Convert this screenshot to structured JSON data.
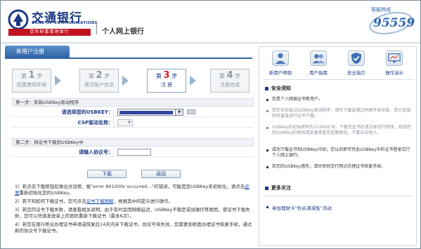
{
  "header": {
    "bank_name_cn": "交通银行",
    "bank_name_en": "BANK OF COMMUNICATIONS",
    "slogan": "您的财富管理银行",
    "system_title": "个人网上银行",
    "hotline_label": "客服热线",
    "hotline_number": "95559"
  },
  "tab": {
    "label": "新用户注册"
  },
  "steps": [
    {
      "prefix": "第",
      "num": "1",
      "suffix": "步",
      "label": "配置使用环境"
    },
    {
      "prefix": "第",
      "num": "2",
      "suffix": "步",
      "label": "填写账户信息"
    },
    {
      "prefix": "第",
      "num": "3",
      "suffix": "步",
      "label": "注    册"
    },
    {
      "prefix": "第",
      "num": "4",
      "suffix": "步",
      "label": "注册完成"
    }
  ],
  "form": {
    "step1_title": "第一步：安装USBKey驱动程序",
    "usbkey_label": "请选择您的USBKEY：",
    "csp_label": "CSP驱动名称：",
    "step2_title": "第二步：将证书下载到USBKey中",
    "pin_label": "请输入协议号：",
    "download_button": "下载",
    "back_button": "返回"
  },
  "notes": [
    {
      "a": "1）若点击下载按钮后弹出对话框，报“error 801000c occurred…”的错误，可能是您USBKey未初始化，请点击",
      "link": "这里",
      "b": "重新初始化您的USBKey。"
    },
    {
      "a": "2）若不知如何下载证书，您可点击",
      "link": "证书下载图解",
      "b": "，根据其中的提示进行操作。"
    },
    {
      "a": "3）若您的证书下载失败，请查看相关说明。由于有时会因网络延迟、USBKey不稳定或误操作等原因，使证书下载失败，您可以凭借发放单上的密码重新下载证书（最多6次）。",
      "link": "",
      "b": ""
    },
    {
      "a": "4）若您在银行柜台办理证书申请或恢复后14天内未下载证书，协议号将失效，您需要到柜面办理证书恢复手续，通过新的协议号下载证书。",
      "link": "",
      "b": ""
    }
  ],
  "sidebar": {
    "quick_links": [
      {
        "label": "新用户帮助",
        "icon": "user-help-icon"
      },
      {
        "label": "用户指南",
        "icon": "user-guide-icon"
      },
      {
        "label": "安全指引",
        "icon": "security-shield-icon"
      },
      {
        "label": "操作演示",
        "icon": "demo-screen-icon"
      }
    ],
    "security_title": "安全须知",
    "security_tips": [
      "您是个人网银证书新用户。",
      "若您未安装过USBKey驱动程序，请先下载或通过同屏传录安装，若已安装则可直接进行证书下载。",
      "USBKey的初始密码为12345678，下载完证书后请立即进行修改，修改后的USBKey的密码请妥善保管及定期修改，不要告诉他人。",
      "成功下载证书到USBKey中后，您以后即可凭此USBKey中的证书登录交行个人网上银行。",
      "若您的USBKey遗失，请尽快到交行网点办理证书恢复手续。"
    ],
    "more_title": "更多关注",
    "promo_link": "参加理财卡“秒杀满减兔”活动"
  }
}
